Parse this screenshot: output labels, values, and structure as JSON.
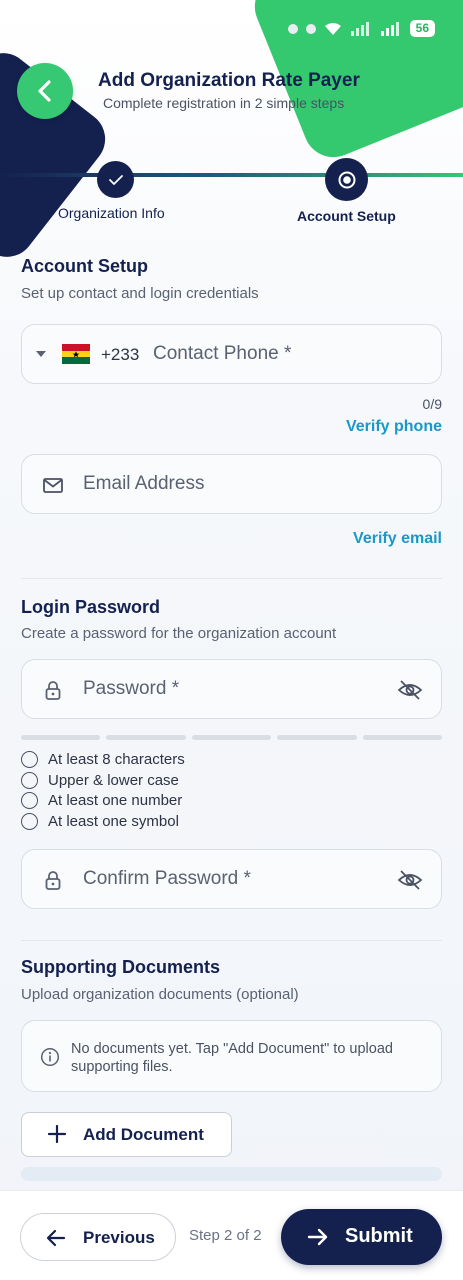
{
  "status_bar": {
    "time": "",
    "battery": "56"
  },
  "header": {
    "title": "Add Organization Rate Payer",
    "subtitle": "Complete registration in 2 simple steps"
  },
  "stepper": {
    "steps": [
      {
        "label": "Organization Info",
        "state": "completed"
      },
      {
        "label": "Account Setup",
        "state": "active"
      }
    ]
  },
  "account_setup": {
    "title": "Account Setup",
    "subtitle": "Set up contact and login credentials",
    "phone": {
      "country_code": "+233",
      "placeholder": "Contact Phone *",
      "counter": "0/9",
      "verify_label": "Verify phone"
    },
    "email": {
      "placeholder": "Email Address",
      "verify_label": "Verify email"
    }
  },
  "login_password": {
    "title": "Login Password",
    "subtitle": "Create a password for the organization account",
    "password_placeholder": "Password *",
    "confirm_placeholder": "Confirm Password *",
    "requirements": [
      "At least 8 characters",
      "Upper & lower case",
      "At least one number",
      "At least one symbol"
    ]
  },
  "supporting_documents": {
    "title": "Supporting Documents",
    "subtitle": "Upload organization documents (optional)",
    "empty_message": "No documents yet. Tap \"Add Document\" to upload supporting files.",
    "add_label": "Add Document"
  },
  "footer": {
    "previous_label": "Previous",
    "step_text": "Step 2 of 2",
    "submit_label": "Submit"
  },
  "colors": {
    "primary_navy": "#14214f",
    "accent_green": "#36c872",
    "link_blue": "#1a98c9"
  }
}
